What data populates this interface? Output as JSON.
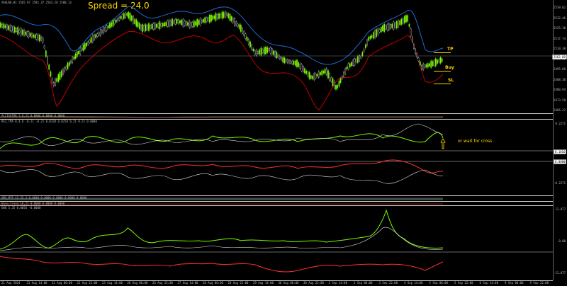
{
  "main_header": "XAUUSD,H1  2565.97 2581.37 2563.28 2580.13",
  "spread_label": "Spread = 24.0",
  "annotations": {
    "tp": "TP",
    "buy": "Buy",
    "sl": "SL",
    "wait": "or wait for cross"
  },
  "price_axis": [
    "2539.82",
    "2532.46",
    "2525.10",
    "2517.74",
    "2510.38",
    "2503.02",
    "2495.66",
    "2488.30",
    "2480.94",
    "2473.58",
    "2466.22"
  ],
  "price_tag": "2563.80",
  "ind1_header": "ALLIGATOR 5,8,13 0.0000 0.0000 0.0000",
  "ind2_header": "RSI_TMA 8,4,0 -0.21 -0.21 0.0228 0.0258 0.21 0.21 0.0000",
  "ind2_axis": [
    "0.2271",
    "0.0000",
    "-0.2271"
  ],
  "ind2_tags": [
    "0.1016",
    "0.0000"
  ],
  "ind3_header": "SMI_MTF 13 25 2 0.0000 0.0000 0.0000 0.0000 0.0000",
  "ind4_header": "Wave_Trend 10,21 0.0000 0.0000 0.0000",
  "ind5_header": "EWO 5,35 0.0056 -0.0000",
  "ind5_axis": [
    "12.077",
    "0.00",
    "-12.077"
  ],
  "time_axis": [
    "21 Aug 2024",
    "21 Aug 14:00",
    "22 Aug 06:00",
    "22 Aug 22:00",
    "23 Aug 14:00",
    "26 Aug 06:00",
    "26 Aug 22:00",
    "27 Aug 14:00",
    "28 Aug 06:00",
    "28 Aug 22:00",
    "29 Aug 14:00",
    "30 Aug 06:00",
    "30 Aug 22:00",
    "2 Sep 14:00",
    "3 Sep 06:00",
    "3 Sep 22:00",
    "4 Sep 14:00",
    "5 Sep 06:00",
    "5 Sep 22:00",
    "6 Sep 14:00",
    "9 Sep 06:00",
    "9 Sep 22:00"
  ],
  "colors": {
    "bull": "#7CFC00",
    "bear": "#ff3030",
    "upper_band": "#1e6bd6",
    "lower_band": "#c00000",
    "annotation": "#ffd700"
  }
}
